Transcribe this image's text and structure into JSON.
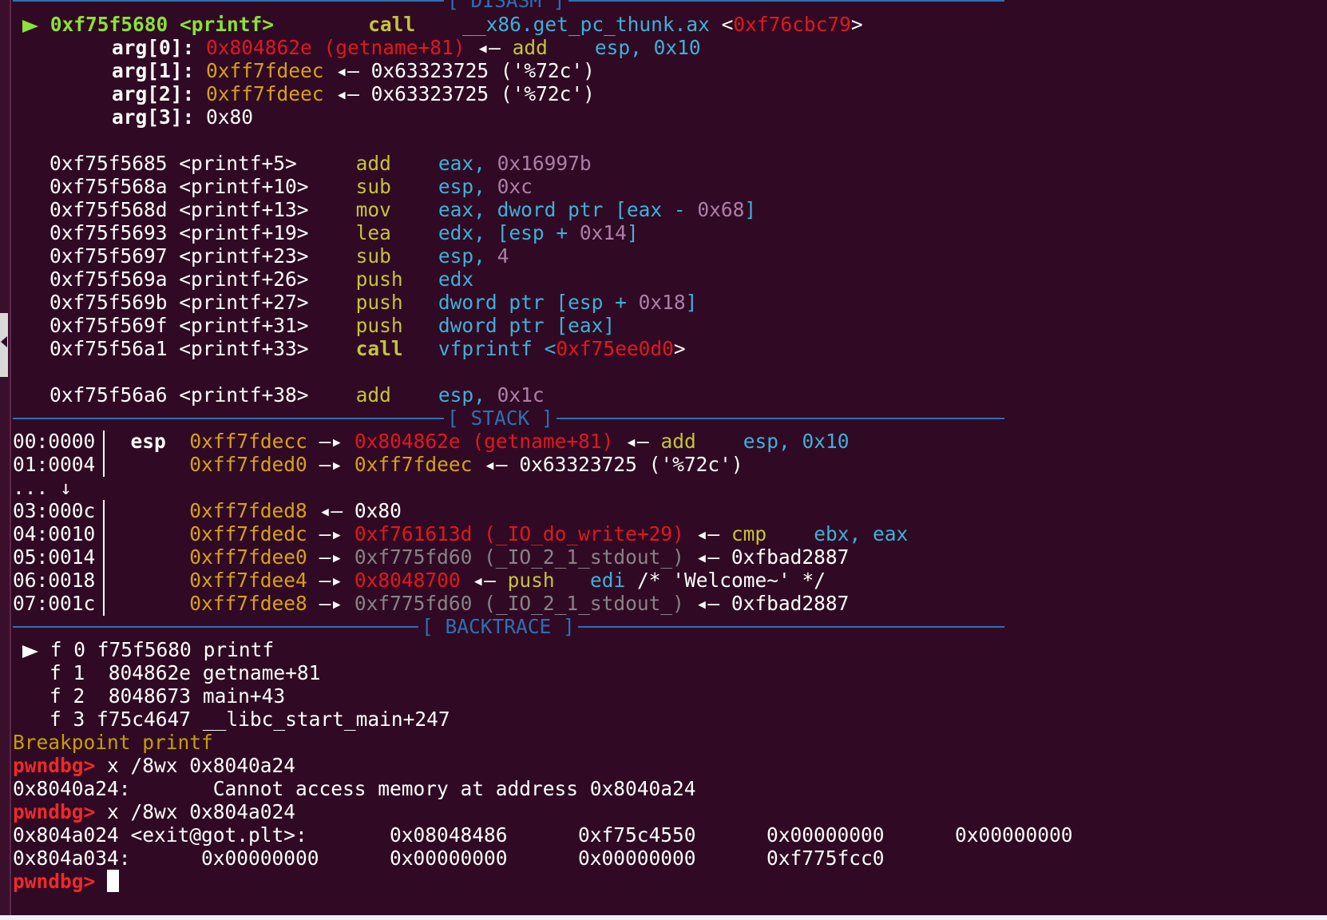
{
  "theme": {
    "background": "#300a24",
    "separator": "#2f6fb0",
    "green": "#8ae234",
    "yellow": "#c4c43a",
    "orange": "#d6a11a",
    "red": "#e0181f",
    "cyan": "#3fb0d8",
    "purple": "#ad7fa8",
    "gray": "#8a8288",
    "prompt": "#ef2929"
  },
  "disasm": {
    "header": "[ DISASM ]",
    "current": {
      "marker": "right-triangle-icon",
      "addr": "0xf75f5680",
      "sym": "<printf>",
      "op": "call",
      "target": "__x86.get_pc_thunk.ax",
      "lt": "<",
      "target_addr": "0xf76cbc79",
      "gt": ">"
    },
    "args": [
      {
        "name": "arg[0]:",
        "val": "0x804862e (getname+81)",
        "arrow": "◂—",
        "op": "add",
        "operands": "esp, 0x10"
      },
      {
        "name": "arg[1]:",
        "val": "0xff7fdeec",
        "arrow": "◂—",
        "rest": "0x63323725 ('%72c')"
      },
      {
        "name": "arg[2]:",
        "val": "0xff7fdeec",
        "arrow": "◂—",
        "rest": "0x63323725 ('%72c')"
      },
      {
        "name": "arg[3]:",
        "val": "0x80"
      }
    ],
    "instructions": [
      {
        "addr": "0xf75f5685",
        "sym": "<printf+5>",
        "op": "add",
        "a": "eax,",
        "b": " 0x16997b"
      },
      {
        "addr": "0xf75f568a",
        "sym": "<printf+10>",
        "op": "sub",
        "a": "esp,",
        "b": " 0xc"
      },
      {
        "addr": "0xf75f568d",
        "sym": "<printf+13>",
        "op": "mov",
        "a": "eax, dword ptr [eax - ",
        "b": "0x68",
        "c": "]"
      },
      {
        "addr": "0xf75f5693",
        "sym": "<printf+19>",
        "op": "lea",
        "a": "edx, [esp + ",
        "b": "0x14",
        "c": "]"
      },
      {
        "addr": "0xf75f5697",
        "sym": "<printf+23>",
        "op": "sub",
        "a": "esp,",
        "b": " 4"
      },
      {
        "addr": "0xf75f569a",
        "sym": "<printf+26>",
        "op": "push",
        "a": "edx"
      },
      {
        "addr": "0xf75f569b",
        "sym": "<printf+27>",
        "op": "push",
        "a": "dword ptr [esp + ",
        "b": "0x18",
        "c": "]"
      },
      {
        "addr": "0xf75f569f",
        "sym": "<printf+31>",
        "op": "push",
        "a": "dword ptr [eax]"
      },
      {
        "addr": "0xf75f56a1",
        "sym": "<printf+33>",
        "op": "call",
        "a": "vfprintf <",
        "b": "0xf75ee0d0",
        "c": ">"
      },
      {
        "addr": "0xf75f56a6",
        "sym": "<printf+38>",
        "op": "add",
        "a": "esp,",
        "b": " 0x1c"
      }
    ]
  },
  "stack": {
    "header": "[ STACK ]",
    "rows": [
      {
        "idx": "00:0000",
        "reg": "esp",
        "addr": "0xff7fdecc",
        "a1": "—▸",
        "v1": "0x804862e (getname+81)",
        "a2": "◂—",
        "op": "add",
        "operands": "esp, 0x10"
      },
      {
        "idx": "01:0004",
        "addr": "0xff7fded0",
        "a1": "—▸",
        "v1": "0xff7fdeec",
        "a2": "◂—",
        "rest": "0x63323725 ('%72c')"
      },
      {
        "idx": "...",
        "skip": "↓"
      },
      {
        "idx": "03:000c",
        "addr": "0xff7fded8",
        "a2": "◂—",
        "rest": "0x80"
      },
      {
        "idx": "04:0010",
        "addr": "0xff7fdedc",
        "a1": "—▸",
        "v1": "0xf761613d (_IO_do_write+29)",
        "a2": "◂—",
        "op": "cmp",
        "operands": "ebx, eax"
      },
      {
        "idx": "05:0014",
        "addr": "0xff7fdee0",
        "a1": "—▸",
        "v1": "0xf775fd60 (_IO_2_1_stdout_)",
        "a2": "◂—",
        "rest": "0xfbad2887"
      },
      {
        "idx": "06:0018",
        "addr": "0xff7fdee4",
        "a1": "—▸",
        "v1": "0x8048700",
        "a2": "◂—",
        "op": "push",
        "operands": "edi",
        "comment": " /* 'Welcome~' */"
      },
      {
        "idx": "07:001c",
        "addr": "0xff7fdee8",
        "a1": "—▸",
        "v1": "0xf775fd60 (_IO_2_1_stdout_)",
        "a2": "◂—",
        "rest": "0xfbad2887"
      }
    ]
  },
  "backtrace": {
    "header": "[ BACKTRACE ]",
    "frames": [
      {
        "f": "f 0",
        "addr": "f75f5680",
        "sym": "printf"
      },
      {
        "f": "f 1",
        "addr": " 804862e",
        "sym": "getname+81"
      },
      {
        "f": "f 2",
        "addr": " 8048673",
        "sym": "main+43"
      },
      {
        "f": "f 3",
        "addr": "f75c4647",
        "sym": "__libc_start_main+247"
      }
    ]
  },
  "console": {
    "breakpoint": "Breakpoint printf",
    "prompt": "pwndbg>",
    "lines": [
      {
        "cmd": "x /8wx 0x8040a24"
      },
      {
        "out": "0x8040a24:       Cannot access memory at address 0x8040a24"
      },
      {
        "cmd": "x /8wx 0x804a024"
      },
      {
        "out": "0x804a024 <exit@got.plt>:       0x08048486      0xf75c4550      0x00000000      0x00000000"
      },
      {
        "out": "0x804a034:      0x00000000      0x00000000      0x00000000      0xf775fcc0"
      }
    ]
  }
}
